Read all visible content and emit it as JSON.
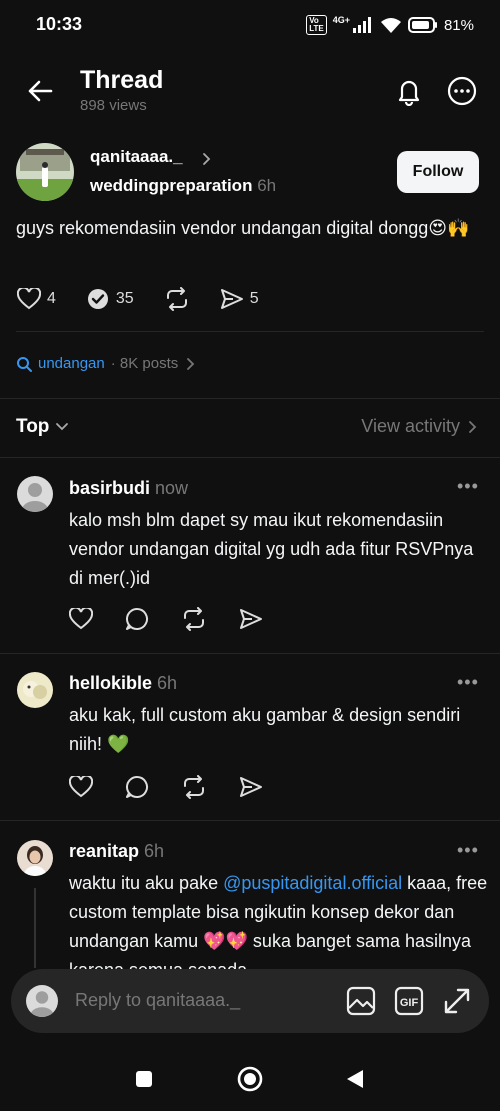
{
  "status_bar": {
    "time": "10:33",
    "volte": "Vo LTE",
    "network": "4G+",
    "battery": "81%"
  },
  "header": {
    "title": "Thread",
    "views": "898 views"
  },
  "post": {
    "username": "qanitaaaa._",
    "topic": "weddingpreparation",
    "time": "6h",
    "follow_label": "Follow",
    "text": "guys rekomendasiin vendor undangan digital dongg😍🙌",
    "likes": "4",
    "replies": "35",
    "shares": "5"
  },
  "tag": {
    "name": "undangan",
    "count": "· 8K posts"
  },
  "sort": {
    "label": "Top",
    "view_activity": "View activity"
  },
  "comments": [
    {
      "username": "basirbudi",
      "time": "now",
      "text": "kalo msh blm dapet sy mau ikut rekomendasiin vendor undangan digital yg udh ada fitur RSVPnya di mer(.)id"
    },
    {
      "username": "hellokible",
      "time": "6h",
      "text": "aku kak, full custom aku gambar & design sendiri niih! 💚"
    },
    {
      "username": "reanitap",
      "time": "6h",
      "text_before": "waktu itu aku pake ",
      "mention": "@puspitadigital.official",
      "text_after": " kaaa, free custom template bisa ngikutin konsep dekor dan undangan kamu 💖💖 suka banget sama hasilnya karena semua senada"
    }
  ],
  "reply": {
    "placeholder": "Reply to qanitaaaa._"
  },
  "icons": {
    "back": "back-arrow-icon",
    "bell": "bell-icon",
    "more": "more-circle-icon",
    "heart": "heart-icon",
    "comment": "comment-icon",
    "repost": "repost-icon",
    "share": "send-icon",
    "search": "search-icon",
    "image": "image-icon",
    "gif": "gif-icon",
    "expand": "expand-icon"
  },
  "colors": {
    "background": "#101010",
    "link": "#3797f0",
    "muted": "#777777"
  }
}
